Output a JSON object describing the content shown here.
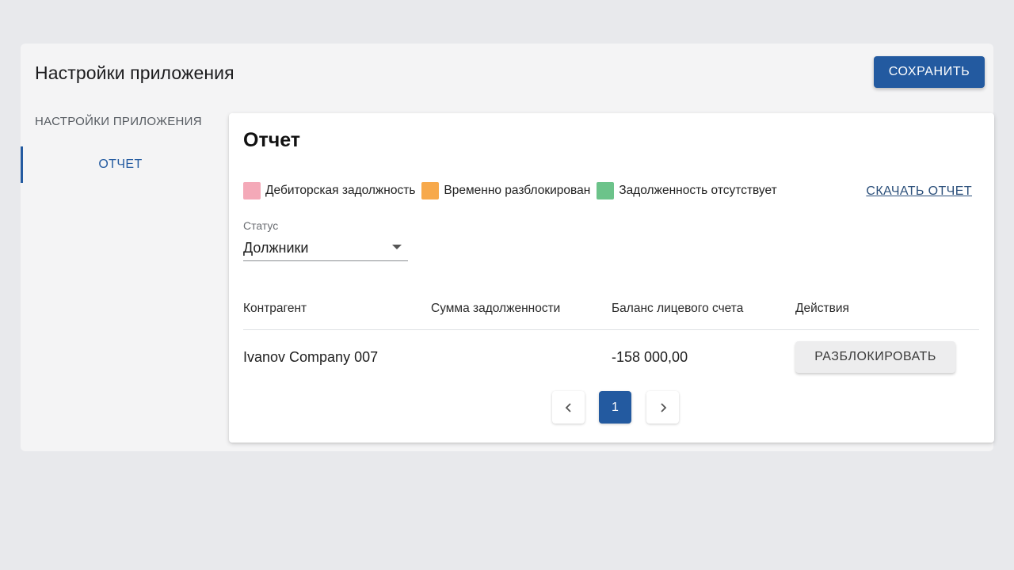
{
  "header": {
    "title": "Настройки приложения",
    "save_label": "СОХРАНИТЬ",
    "accent_color": "#235aa0"
  },
  "sidebar": {
    "section_title": "НАСТРОЙКИ ПРИЛОЖЕНИЯ",
    "items": [
      {
        "label": "ОТЧЕТ",
        "active": true
      }
    ]
  },
  "report": {
    "title": "Отчет",
    "legend": [
      {
        "label": "Дебиторская задолжность",
        "color": "#f4a9b8"
      },
      {
        "label": "Временно разблокирован",
        "color": "#f7a94b"
      },
      {
        "label": "Задолженность отсутствует",
        "color": "#6cc38a"
      }
    ],
    "download_label": "СКАЧАТЬ ОТЧЕТ",
    "status_filter": {
      "label": "Статус",
      "value": "Должники"
    },
    "table": {
      "columns": [
        "Контрагент",
        "Сумма задолженности",
        "Баланс лицевого счета",
        "Действия"
      ],
      "rows": [
        {
          "counterparty": "Ivanov Company 007",
          "debt_amount": "",
          "balance": "-158 000,00",
          "action_label": "РАЗБЛОКИРОВАТЬ"
        }
      ]
    },
    "pagination": {
      "prev_icon": "chevron-left-icon",
      "next_icon": "chevron-right-icon",
      "pages": [
        "1"
      ],
      "current_page": "1"
    }
  }
}
